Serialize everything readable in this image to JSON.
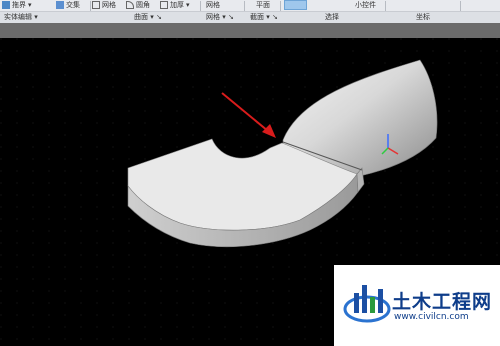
{
  "ribbon": {
    "tools": {
      "extrude": "拖界",
      "intersect": "交集",
      "mesh": "网格",
      "fillet": "圆角",
      "thicken": "加厚",
      "mesh2": "网格",
      "plane": "平面",
      "small_widget": "小控件"
    },
    "groups": {
      "solid_edit": "实体编辑",
      "surface": "曲面",
      "mesh": "网格",
      "section": "截面",
      "selection": "选择",
      "coordinates": "坐标"
    }
  },
  "logo": {
    "title": "土木工程网",
    "url": "www.civilcn.com"
  },
  "colors": {
    "arrow": "#d91c1c",
    "logo_blue": "#0e3d8a",
    "model_light": "#e6e6e6",
    "model_dark": "#8a8a8a"
  }
}
